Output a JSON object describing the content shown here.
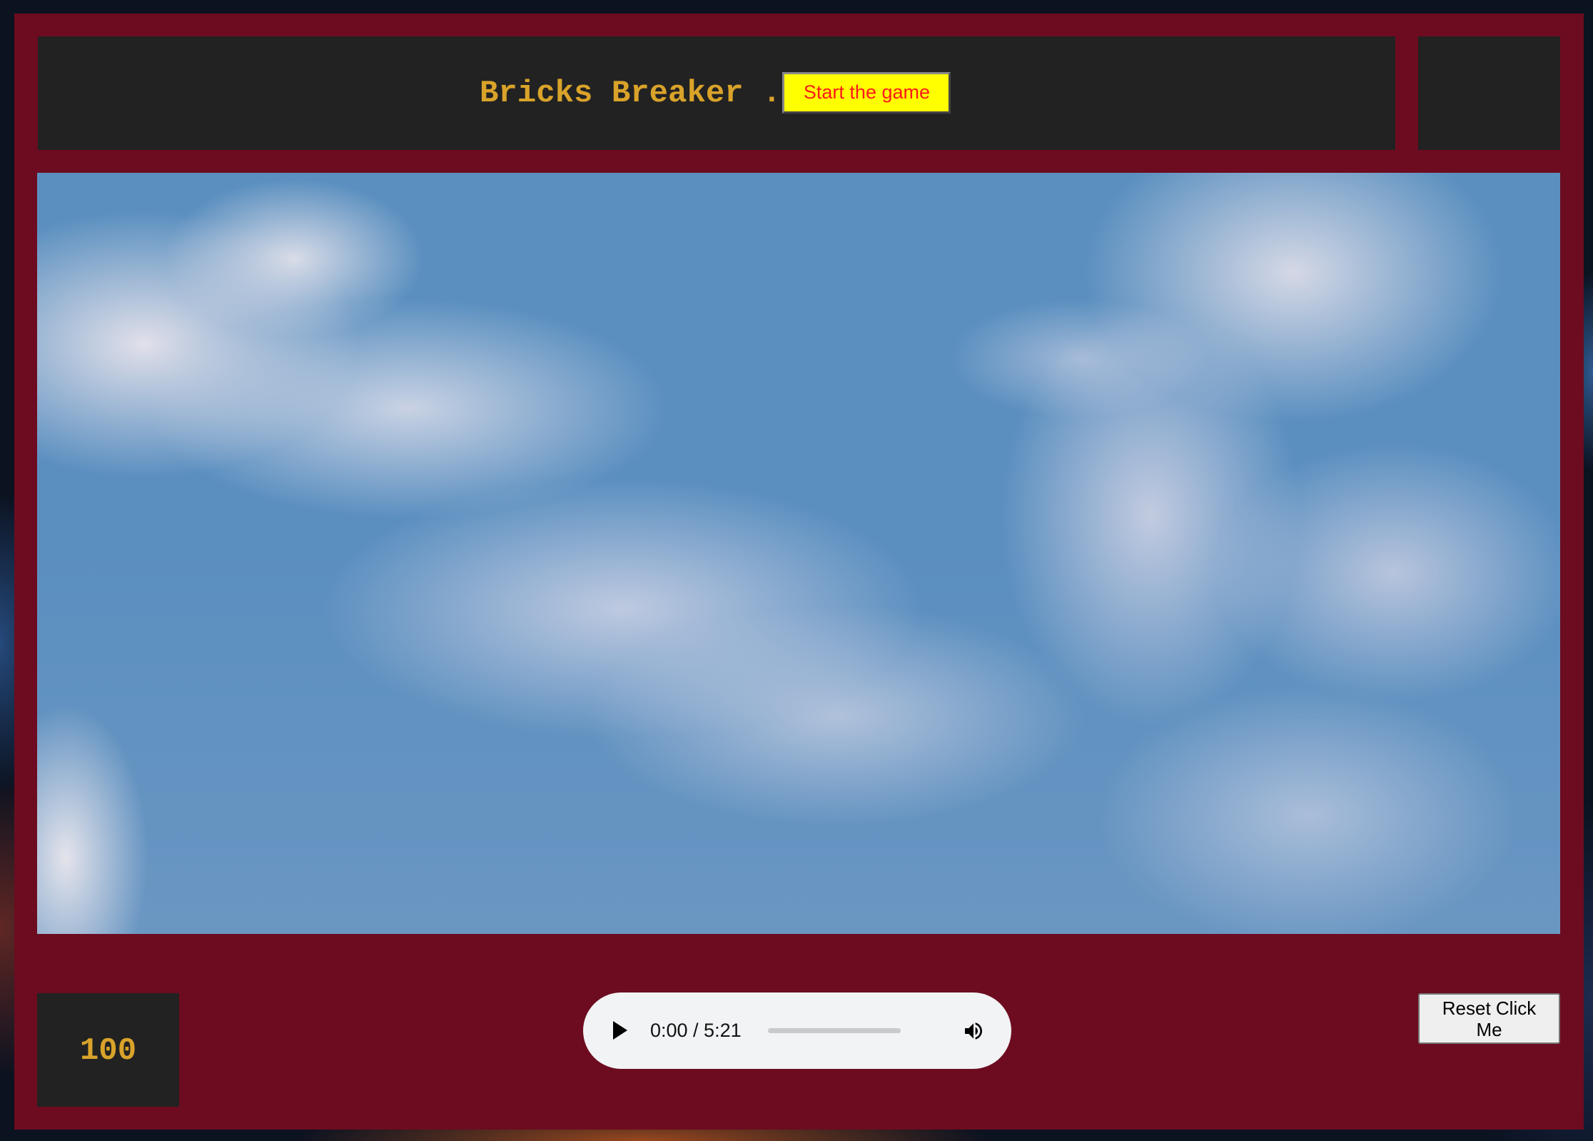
{
  "header": {
    "title": "Bricks Breaker .",
    "start_button_label": "Start the game"
  },
  "score": {
    "value": "100"
  },
  "audio_player": {
    "time_display": "0:00 / 5:21",
    "current_time": "0:00",
    "duration": "5:21",
    "progress": 0,
    "play_icon": "play-icon",
    "volume_icon": "volume-icon"
  },
  "controls": {
    "reset_button_label": "Reset Click Me"
  },
  "colors": {
    "frame": "#6d0c20",
    "panel": "#222222",
    "title_text": "#d9a32a",
    "start_button_bg": "#ffff00",
    "start_button_text": "#ff1a1a"
  }
}
